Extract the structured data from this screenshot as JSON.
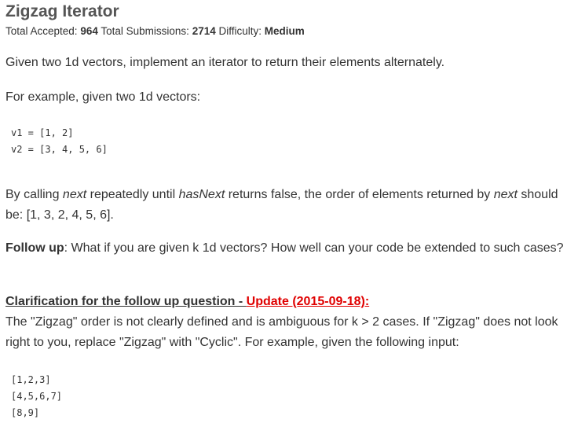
{
  "problem": {
    "title": "Zigzag Iterator",
    "stats": {
      "accepted_label": "Total Accepted:",
      "accepted_value": "964",
      "submissions_label": "Total Submissions:",
      "submissions_value": "2714",
      "difficulty_label": "Difficulty:",
      "difficulty_value": "Medium"
    },
    "description": "Given two 1d vectors, implement an iterator to return their elements alternately.",
    "example_intro": "For example, given two 1d vectors:",
    "example_code": [
      "v1 = [1, 2]",
      "v2 = [3, 4, 5, 6]"
    ],
    "order": {
      "part1": "By calling ",
      "next1": "next",
      "part2": " repeatedly until ",
      "hasnext": "hasNext",
      "part3": " returns false, the order of elements returned by ",
      "next2": "next",
      "part4": " should be: [1, 3, 2, 4, 5, 6]."
    },
    "followup": {
      "label": "Follow up",
      "text": ": What if you are given k 1d vectors? How well can your code be extended to such cases?"
    },
    "clarification": {
      "heading": "Clarification for the follow up question - ",
      "update": "Update (2015-09-18):",
      "text": "The \"Zigzag\" order is not clearly defined and is ambiguous for k > 2 cases. If \"Zigzag\" does not look right to you, replace \"Zigzag\" with \"Cyclic\". For example, given the following input:"
    },
    "input_code": [
      "[1,2,3]",
      "[4,5,6,7]",
      "[8,9]"
    ]
  }
}
